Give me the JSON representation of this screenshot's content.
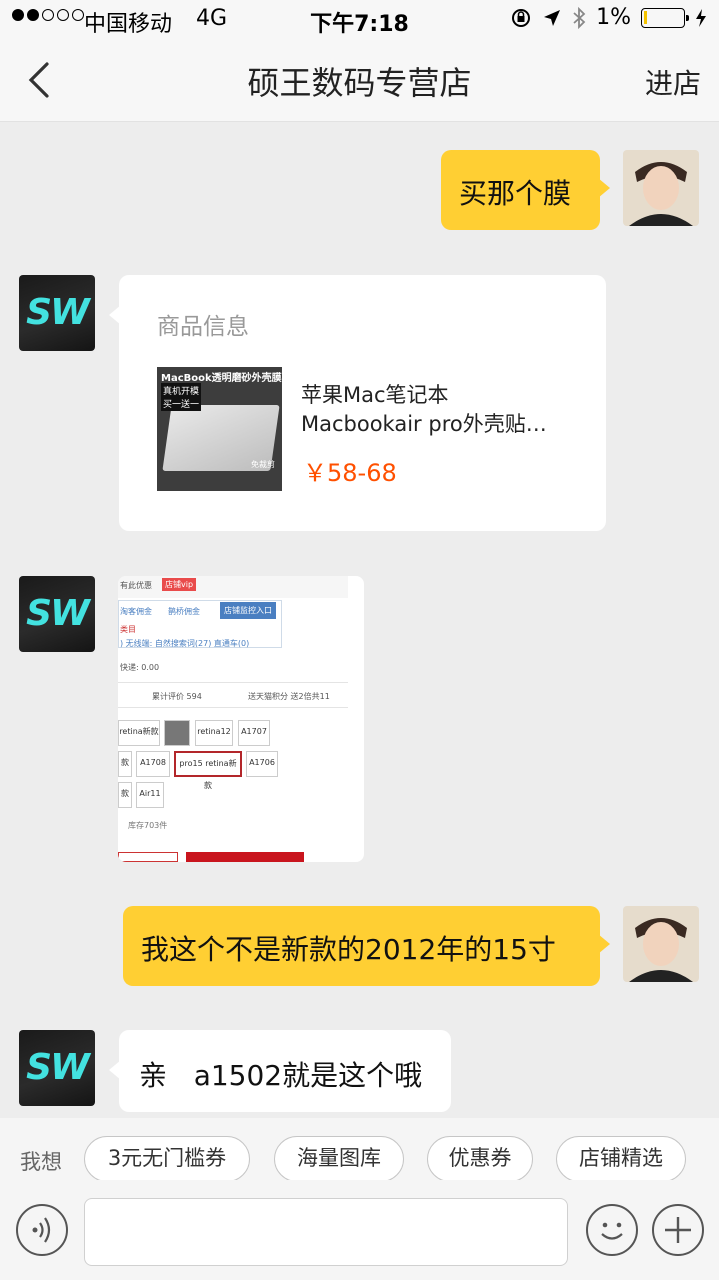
{
  "status_bar": {
    "carrier": "中国移动",
    "network": "4G",
    "time": "下午7:18",
    "battery": "1%",
    "battery_level": 0.01
  },
  "header": {
    "title": "硕王数码专营店",
    "store_link": "进店",
    "back_icon": "chevron-left-icon"
  },
  "avatars": {
    "store_avatar": "SW"
  },
  "messages": [
    {
      "side": "me",
      "type": "text",
      "text": "买那个膜"
    },
    {
      "side": "them",
      "type": "product",
      "label": "商品信息",
      "image_lines": [
        "MacBook透明磨砂外壳膜",
        "真机开模",
        "买一送一",
        "免裁剪"
      ],
      "name_line1": "苹果Mac笔记本",
      "name_line2": "Macbookair pro外壳贴…",
      "price": "￥58-68"
    },
    {
      "side": "them",
      "type": "screenshot",
      "lines": {
        "promo": "有此优惠",
        "vip": "店铺vip",
        "tab1": "淘客佣金",
        "tab2": "鹊桥佣金",
        "tab3": "店铺监控入口",
        "category": "类目",
        "keywords": ") 无线端: 自然搜索词(27) 直通车(0)",
        "shipping": "快递: 0.00",
        "reviews": "累计评价 594",
        "points": "送天猫积分 送2倍共11",
        "opt1": "retina新款",
        "opt2": "retina12",
        "opt3": "A1707",
        "opt4": "款",
        "opt5": "A1708",
        "opt6": "pro15 retina新款",
        "opt7": "A1706",
        "opt8": "款",
        "opt9": "Air11",
        "stock": "库存703件"
      }
    },
    {
      "side": "me",
      "type": "text",
      "text": "我这个不是新款的2012年的15寸"
    },
    {
      "side": "them",
      "type": "text",
      "text": "亲   a1502就是这个哦"
    }
  ],
  "quick_replies": {
    "label": "我想",
    "chips": [
      "3元无门槛券",
      "海量图库",
      "优惠券",
      "店铺精选"
    ]
  },
  "input_bar": {
    "voice_icon": "voice-icon",
    "emoji_icon": "emoji-icon",
    "plus_icon": "plus-icon",
    "input_value": ""
  }
}
